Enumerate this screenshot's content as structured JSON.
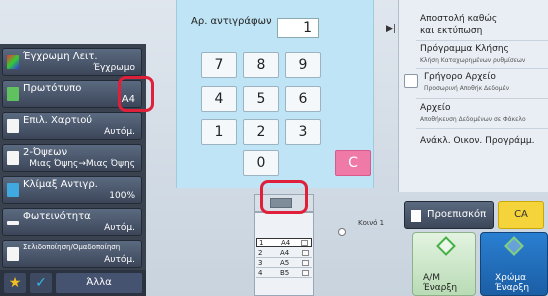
{
  "left_menu": {
    "item1_title": "Έγχρωμη Λειτ.",
    "item1_value": "Έγχρωμο",
    "item2_title": "Πρωτότυπο",
    "item2_value": "A4",
    "item3_title": "Επιλ. Χαρτιού",
    "item3_value": "Αυτόμ.",
    "item4_title": "2-Όψεων",
    "item4_value": "Μιας Όψης→Μιας Όψης",
    "item5_title": "Κλίμαξ Αντιγρ.",
    "item5_value": "100%",
    "item6_title": "Φωτεινότητα",
    "item6_value": "Αυτόμ.",
    "item7_title": "Σελιδοποίηση/Ομαδοποίηση",
    "item7_value": "Αυτόμ."
  },
  "bottom_bar": {
    "star": "★",
    "check": "✓",
    "other": "Άλλα"
  },
  "copies": {
    "label": "Αρ. αντιγράφων",
    "value": "1"
  },
  "keypad": {
    "k7": "7",
    "k8": "8",
    "k9": "9",
    "k4": "4",
    "k5": "5",
    "k6": "6",
    "k1": "1",
    "k2": "2",
    "k3": "3",
    "k0": "0",
    "clear": "C"
  },
  "right_panel": {
    "send_print": "Αποστολή καθώς",
    "send_print2": "και εκτύπωση",
    "call_program": "Πρόγραμμα Κλήσης",
    "call_program_sub": "Κλήση Καταχωρημένων ρυθμίσεων",
    "quick_file": "Γρήγορο Αρχείο",
    "quick_file_sub": "Προσωρινή Αποθήκ Δεδομέν",
    "file": "Αρχείο",
    "file_sub": "Αποθήκευση Δεδομένων σε Φάκελο",
    "recall_eco": "Ανάκλ. Οικον. Προγράμμ."
  },
  "trays": {
    "label": "Κοινό 1",
    "rows": [
      {
        "n": "1",
        "size": "A4"
      },
      {
        "n": "2",
        "size": "A4"
      },
      {
        "n": "3",
        "size": "A5"
      },
      {
        "n": "4",
        "size": "B5"
      }
    ]
  },
  "actions": {
    "preview": "Προεπισκόπ",
    "ca": "CA",
    "bw_start_1": "A/M",
    "bw_start_2": "Έναρξη",
    "color_start_1": "Χρώμα",
    "color_start_2": "Έναρξη"
  },
  "colors": {
    "keypad_bg": "#bfe4f5",
    "clear_key": "#f07aa7",
    "highlight": "#e0203a",
    "ca": "#f5d33a",
    "color_start": "#2a7fd1"
  }
}
